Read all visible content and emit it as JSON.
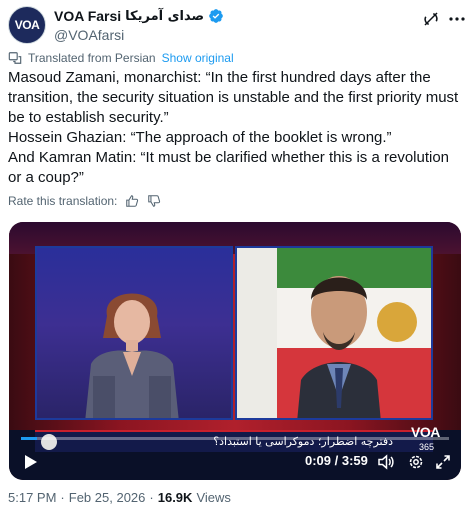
{
  "author": {
    "display_name": "VOA Farsi",
    "display_name_fa": "صدای آمریکا",
    "handle": "@VOAfarsi",
    "avatar_text": "VOA",
    "verified": true
  },
  "translation": {
    "label": "Translated from Persian",
    "show_original": "Show original"
  },
  "tweet": {
    "lines": [
      "Masoud Zamani, monarchist: “In the first hundred days after the transition, the security situation is unstable and the first priority must be to establish security.”",
      "Hossein Ghazian: “The approach of the booklet is wrong.”",
      "And Kamran Matin: “It must be clarified whether this is a revolution or a coup?”"
    ]
  },
  "rate": {
    "label": "Rate this translation:"
  },
  "video": {
    "ticker_text": "دفترچه اضطرار؛ دموکراسی یا استبداد؟",
    "watermark": "VOA",
    "watermark_sub": "365",
    "current_time": "0:09",
    "separator": " / ",
    "duration": "3:59",
    "progress_fraction": 0.038
  },
  "meta": {
    "time": "5:17 PM",
    "dot1": "·",
    "date": "Feb 25, 2026",
    "dot2": "·",
    "views": "16.9K",
    "views_label": "Views"
  },
  "colors": {
    "link": "#1d9bf0",
    "secondary_text": "#536471",
    "primary_text": "#0f1419"
  },
  "icons": {
    "verified": "verified-badge-icon",
    "grok": "grok-icon",
    "more": "more-icon",
    "translate": "translate-icon",
    "thumbs_up": "thumbs-up-icon",
    "thumbs_down": "thumbs-down-icon",
    "play": "play-icon",
    "volume": "volume-icon",
    "settings": "settings-icon",
    "fullscreen": "fullscreen-icon"
  }
}
